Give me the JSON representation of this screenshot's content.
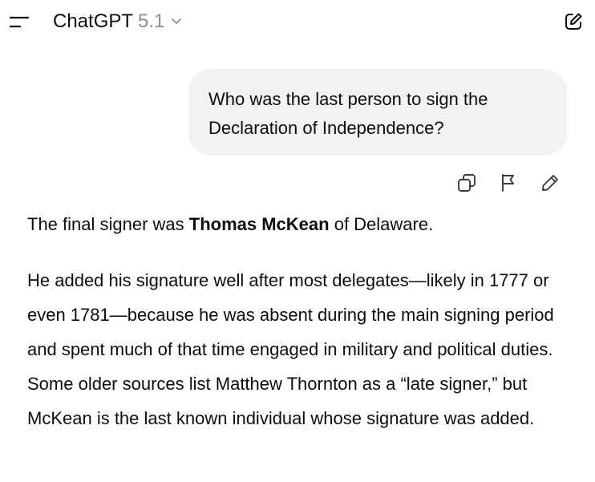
{
  "header": {
    "model_name": "ChatGPT",
    "model_version": "5.1",
    "menu_icon": "menu-icon",
    "dropdown_icon": "chevron-down-icon",
    "new_chat_icon": "compose-icon"
  },
  "conversation": {
    "user_message": "Who was the last person to sign the Declaration of Independence?",
    "message_actions": [
      {
        "icon": "copy-icon"
      },
      {
        "icon": "flag-icon"
      },
      {
        "icon": "pencil-icon"
      }
    ],
    "assistant": {
      "p1_before": "The final signer was ",
      "p1_bold": "Thomas McKean",
      "p1_after": " of Delaware.",
      "p2": "He added his signature well after most delegates—likely in 1777 or even 1781—because he was absent during the main signing period and spent much of that time engaged in military and political duties. Some older sources list Matthew Thornton as a “late signer,” but McKean is the last known individual whose signature was added."
    }
  },
  "colors": {
    "text": "#0d0d0d",
    "muted": "#8e8e8e",
    "bubble": "#f2f2f2",
    "background": "#ffffff"
  }
}
